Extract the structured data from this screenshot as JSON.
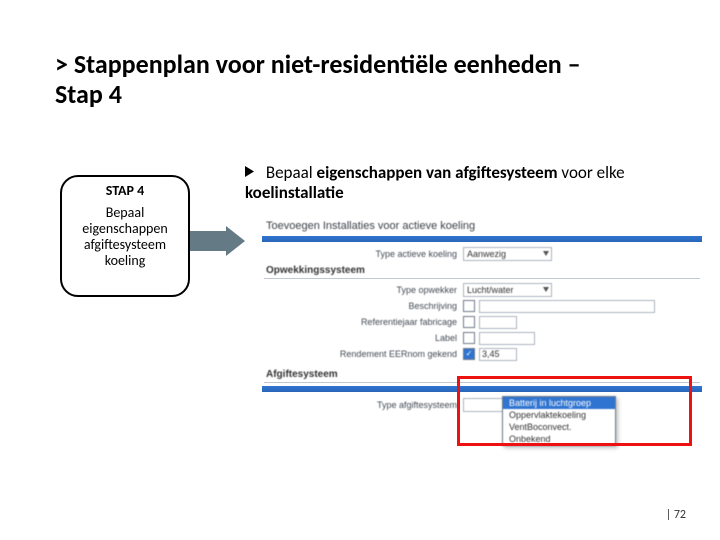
{
  "title_prefix": "> ",
  "title_line1": "Stappenplan voor niet-residentiële eenheden – ",
  "title_line2": "Stap 4",
  "step_box": {
    "heading": "STAP 4",
    "line1": "Bepaal",
    "line2": "eigenschappen",
    "line3": "afgiftesysteem",
    "line4": "koeling"
  },
  "bullet": {
    "prefix": "Bepaal ",
    "bold1": "eigenschappen van afgiftesysteem ",
    "mid": "voor elke ",
    "bold2": "koelinstallatie"
  },
  "screenshot": {
    "top_title": "Toevoegen Installaties voor actieve koeling",
    "row_type_actief": {
      "label": "Type actieve koeling",
      "value": "Aanwezig"
    },
    "section1": "Opwekkingssysteem",
    "rows": {
      "type_opwekker": {
        "label": "Type opwekker",
        "value": "Lucht/water"
      },
      "beschrijving": {
        "label": "Beschrijving"
      },
      "refjaar": {
        "label": "Referentiejaar fabricage"
      },
      "label": {
        "label": "Label"
      },
      "rendement": {
        "label": "Rendement EERnom gekend",
        "checked": true,
        "value": "3,45"
      }
    },
    "section2": "Afgiftesysteem",
    "afgifte_row_label": "Type afgiftesysteem",
    "dropdown_options": [
      "Batterij in luchtgroep",
      "Oppervlaktekoeling",
      "VentBoconvect.",
      "Onbekend"
    ]
  },
  "page_number": "| 72"
}
